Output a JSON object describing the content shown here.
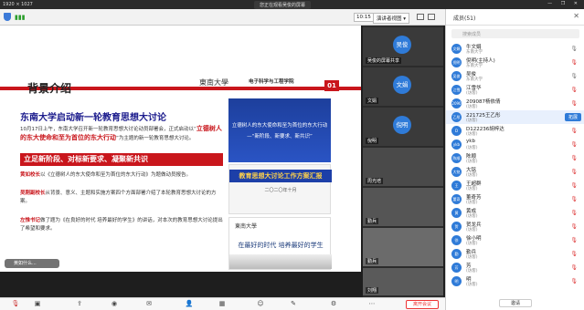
{
  "topbar": {
    "resolution": "1920 × 1027",
    "share_notice": "您正在观看吴俊的屏幕",
    "window_controls": "— ❐ ✕"
  },
  "toolbar": {
    "time": "10:15",
    "view_mode": "演讲者视图 ▾"
  },
  "slide": {
    "title": "背景介绍",
    "logo_school": "東南大學",
    "logo_college": "电子科学与工程学院",
    "page_number": "01",
    "heading": "东南大学启动新一轮教育思想大讨论",
    "para_text": "10月17日上午，东南大学召开新一轮教育思想大讨论动员部署会，正式启动以“",
    "para_red": "立德树人的东大使命和至为首位的东大行动",
    "para_tail": "”为主题的新一轮教育思想大讨论。",
    "banner": "立足新阶段、对标新要求、凝聚新共识",
    "point1_red": "黄如校长",
    "point1_text": "以《立德树人的东大使命和至为首位的东大行动》为题做动员报告。",
    "point2_red": "吴刚副校长",
    "point2_text": "从背景、意义、主题和实施方案四个方面部署介绍了本轮教育思想大讨论的方案。",
    "point3_red": "左惟书记",
    "point3_text": "做了题为《在良好的时代 培养最好的学生》的讲话，对本次的教育思想大讨论提出了希望和要求。",
    "cover1_text": "立德树人的东大使命和至为首位的东大行动",
    "cover1_sub": "—“新阶段、新要求、新共识”",
    "cover2_title": "教育思想大讨论工作方案汇报",
    "cover2_sub": "二〇二〇年十月",
    "cover3_seal": "東南大學",
    "cover3_motto": "在最好的时代 培养最好的学生",
    "overlay_pill": "黄如什么..."
  },
  "videos": [
    {
      "avatar": "吴俊",
      "name": "吴俊的屏幕共享"
    },
    {
      "avatar": "文娟",
      "name": "文娟"
    },
    {
      "avatar": "倪明",
      "name": "倪明"
    },
    {
      "avatar": "",
      "name": "周光培"
    },
    {
      "avatar": "",
      "name": "勤兵"
    },
    {
      "avatar": "",
      "name": "勤兵"
    },
    {
      "avatar": "",
      "name": "刘翔"
    }
  ],
  "panel": {
    "title": "成员(51)",
    "search_placeholder": "搜索成员",
    "invite": "邀请",
    "members": [
      {
        "avatar": "文娟",
        "name": "牛文娟",
        "role": "东南大学",
        "btn": ""
      },
      {
        "avatar": "倪明",
        "name": "倪明(主持人)",
        "role": "东南大学",
        "btn": ""
      },
      {
        "avatar": "吴俊",
        "name": "吴俊",
        "role": "东南大学",
        "btn": ""
      },
      {
        "avatar": "江雪",
        "name": "江雪华",
        "role": "(访客)",
        "btn": ""
      },
      {
        "avatar": "2090",
        "name": "209087杨依倩",
        "role": "(访客)",
        "btn": ""
      },
      {
        "avatar": "乙彤",
        "name": "221725王乙彤",
        "role": "(访客)",
        "btn": "拓展"
      },
      {
        "avatar": "D",
        "name": "D122236胡梓达",
        "role": "(访客)",
        "btn": ""
      },
      {
        "avatar": "ykb",
        "name": "ykb",
        "role": "(访客)",
        "btn": ""
      },
      {
        "avatar": "陈顺",
        "name": "陈顺",
        "role": "(访客)",
        "btn": ""
      },
      {
        "avatar": "大铭",
        "name": "大铭",
        "role": "(访客)",
        "btn": ""
      },
      {
        "avatar": "王",
        "name": "王超群",
        "role": "(访客)",
        "btn": ""
      },
      {
        "avatar": "董奇",
        "name": "董奇芳",
        "role": "(访客)",
        "btn": ""
      },
      {
        "avatar": "黄",
        "name": "黄成",
        "role": "(访客)",
        "btn": ""
      },
      {
        "avatar": "贺",
        "name": "贺龙兵",
        "role": "(访客)",
        "btn": ""
      },
      {
        "avatar": "徐",
        "name": "徐小明",
        "role": "(访客)",
        "btn": ""
      },
      {
        "avatar": "勤",
        "name": "勤兵",
        "role": "(访客)",
        "btn": ""
      },
      {
        "avatar": "芳",
        "name": "芳",
        "role": "(访客)",
        "btn": ""
      },
      {
        "avatar": "明",
        "name": "明",
        "role": "(访客)",
        "btn": ""
      }
    ]
  },
  "bottom": {
    "leave": "离开会议"
  }
}
